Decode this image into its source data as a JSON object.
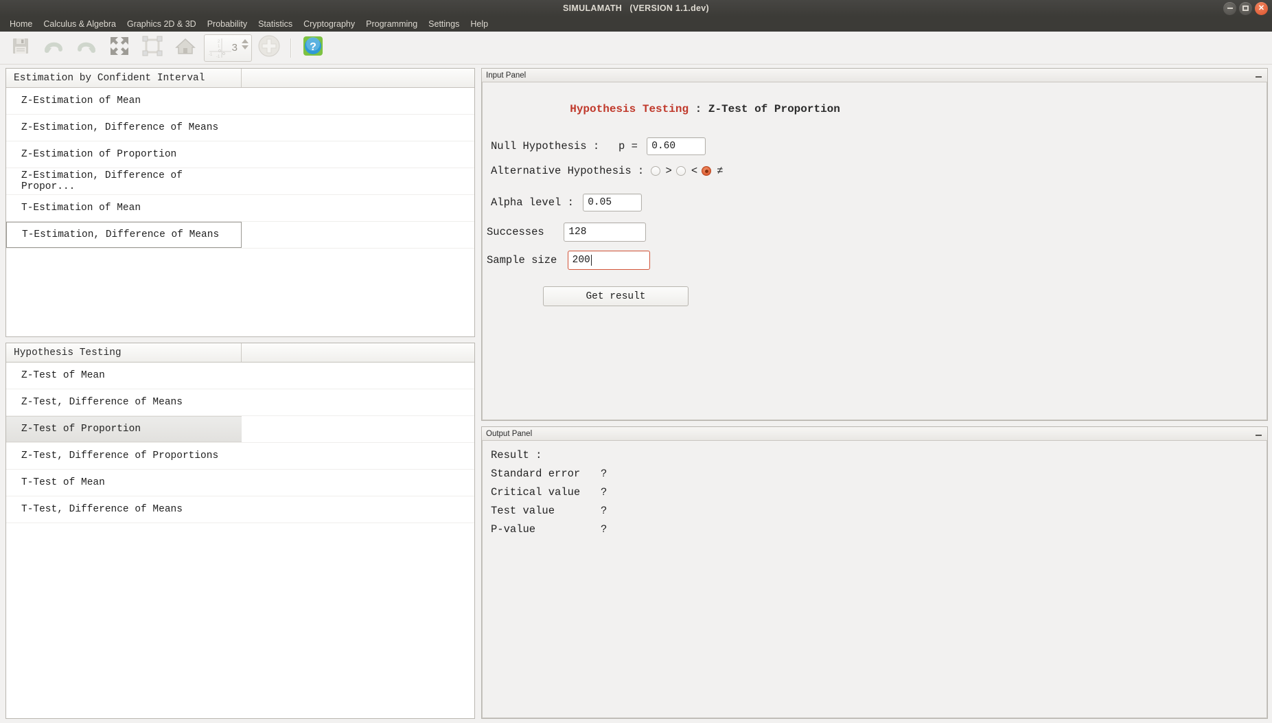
{
  "window": {
    "title": "SIMULAMATH   (VERSION 1.1.dev)",
    "controls": {
      "minimize": "minimize-button",
      "maximize": "maximize-button",
      "close": "close-button"
    }
  },
  "menubar": {
    "items": [
      {
        "label": "Home"
      },
      {
        "label": "Calculus & Algebra"
      },
      {
        "label": "Graphics 2D & 3D"
      },
      {
        "label": "Probability"
      },
      {
        "label": "Statistics"
      },
      {
        "label": "Cryptography"
      },
      {
        "label": "Programming"
      },
      {
        "label": "Settings"
      },
      {
        "label": "Help"
      }
    ]
  },
  "toolbar": {
    "buttons": [
      {
        "name": "save-icon"
      },
      {
        "name": "undo-icon"
      },
      {
        "name": "redo-icon"
      },
      {
        "name": "expand-icon"
      },
      {
        "name": "fit-selection-icon"
      },
      {
        "name": "home-icon"
      }
    ],
    "spinner": {
      "value": "3"
    },
    "plus_button": {
      "name": "add-icon"
    },
    "help_button": {
      "name": "help-icon",
      "glyph": "?"
    }
  },
  "estimation_panel": {
    "header": "Estimation by Confident Interval",
    "items": [
      {
        "label": "Z-Estimation of Mean",
        "state": "normal"
      },
      {
        "label": "Z-Estimation, Difference of Means",
        "state": "normal"
      },
      {
        "label": "Z-Estimation of Proportion",
        "state": "normal"
      },
      {
        "label": "Z-Estimation, Difference of Propor...",
        "state": "normal"
      },
      {
        "label": "T-Estimation of Mean",
        "state": "normal"
      },
      {
        "label": "T-Estimation, Difference of Means",
        "state": "focused"
      }
    ]
  },
  "hypothesis_panel": {
    "header": "Hypothesis Testing",
    "items": [
      {
        "label": "Z-Test of Mean",
        "state": "normal"
      },
      {
        "label": "Z-Test, Difference of Means",
        "state": "normal"
      },
      {
        "label": "Z-Test of Proportion",
        "state": "selected"
      },
      {
        "label": "Z-Test, Difference of Proportions",
        "state": "normal"
      },
      {
        "label": "T-Test of Mean",
        "state": "normal"
      },
      {
        "label": "T-Test, Difference of Means",
        "state": "normal"
      }
    ]
  },
  "input_panel": {
    "dock_title": "Input Panel",
    "heading_red": "Hypothesis Testing",
    "heading_rest": " : Z-Test of Proportion",
    "null_hypothesis_label": "Null Hypothesis :   p = ",
    "null_hypothesis_value": "0.60",
    "alternative_label": "Alternative Hypothesis : ",
    "alternatives": [
      {
        "symbol": ">",
        "checked": false
      },
      {
        "symbol": "<",
        "checked": false
      },
      {
        "symbol": "≠",
        "checked": true
      }
    ],
    "alpha_label": "Alpha level : ",
    "alpha_value": "0.05",
    "successes_label": "Successes  ",
    "successes_value": "128",
    "sample_size_label": "Sample size ",
    "sample_size_value": "200",
    "get_result_label": "Get result"
  },
  "output_panel": {
    "dock_title": "Output Panel",
    "result_label": "Result :",
    "rows": [
      {
        "label": "Standard error",
        "value": "?"
      },
      {
        "label": "Critical value",
        "value": "?"
      },
      {
        "label": "Test value",
        "value": "?"
      },
      {
        "label": "P-value",
        "value": "?"
      }
    ]
  },
  "colors": {
    "titlebar": "#3c3b37",
    "accent_red": "#c0392b",
    "radio_selected": "#e2693f",
    "focus_border": "#d4553a",
    "panel_bg": "#f2f1f0"
  }
}
